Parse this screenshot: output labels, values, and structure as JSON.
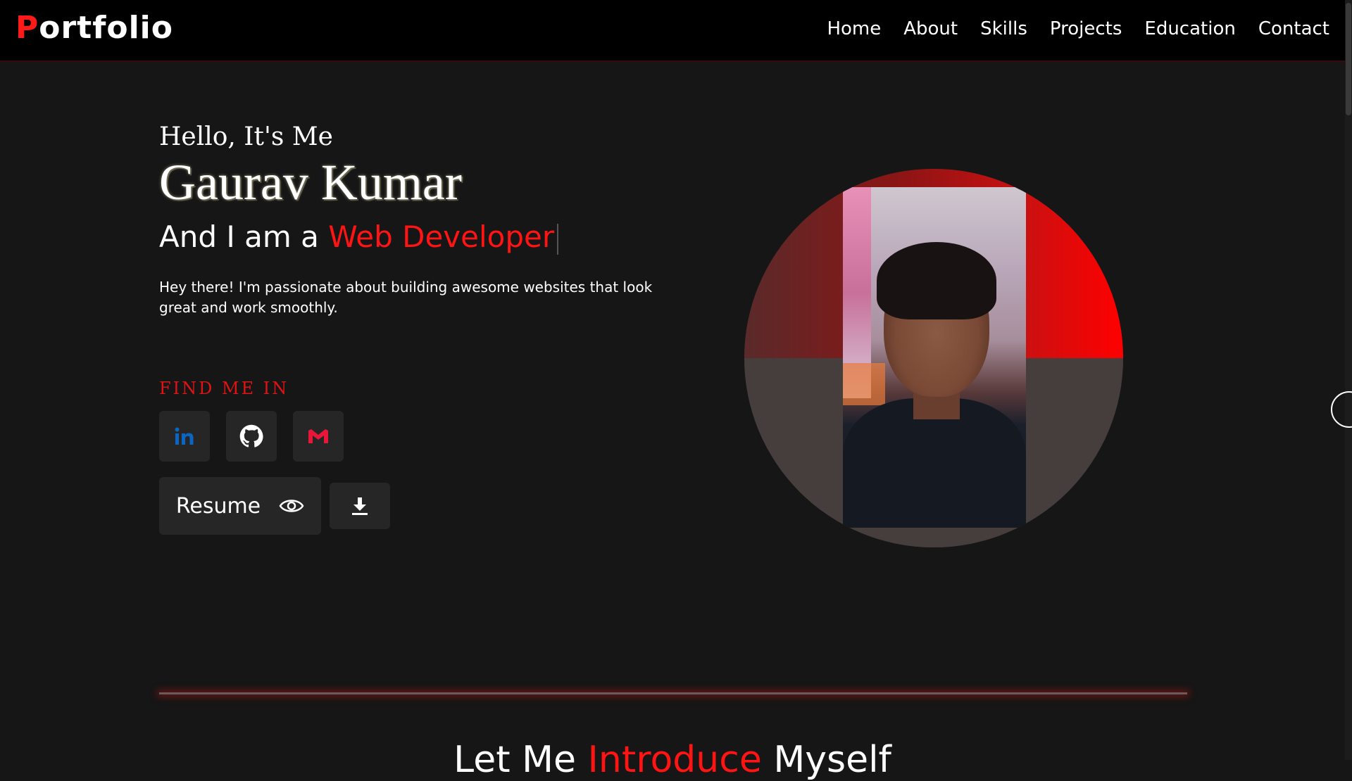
{
  "navbar": {
    "logo_first": "P",
    "logo_rest": "ortfolio",
    "links": [
      "Home",
      "About",
      "Skills",
      "Projects",
      "Education",
      "Contact"
    ]
  },
  "hero": {
    "greeting": "Hello, It's Me",
    "name": "Gaurav Kumar",
    "role_prefix": "And I am a ",
    "role_accent": "Web Developer",
    "intro": "Hey there! I'm passionate about building awesome websites that look great and work smoothly.",
    "find_me": "FIND ME IN",
    "social": [
      {
        "name": "linkedin-icon",
        "color": "#0a66c2"
      },
      {
        "name": "github-icon",
        "color": "#ffffff"
      },
      {
        "name": "gmail-icon",
        "color": "#e8173a"
      }
    ],
    "resume_label": "Resume"
  },
  "colors": {
    "accent": "#ff1414",
    "background": "#161616",
    "navbar": "#000000",
    "button": "#262626"
  },
  "next_section": {
    "title_prefix": "Let Me ",
    "title_accent": "Introduce",
    "title_suffix": " Myself"
  }
}
